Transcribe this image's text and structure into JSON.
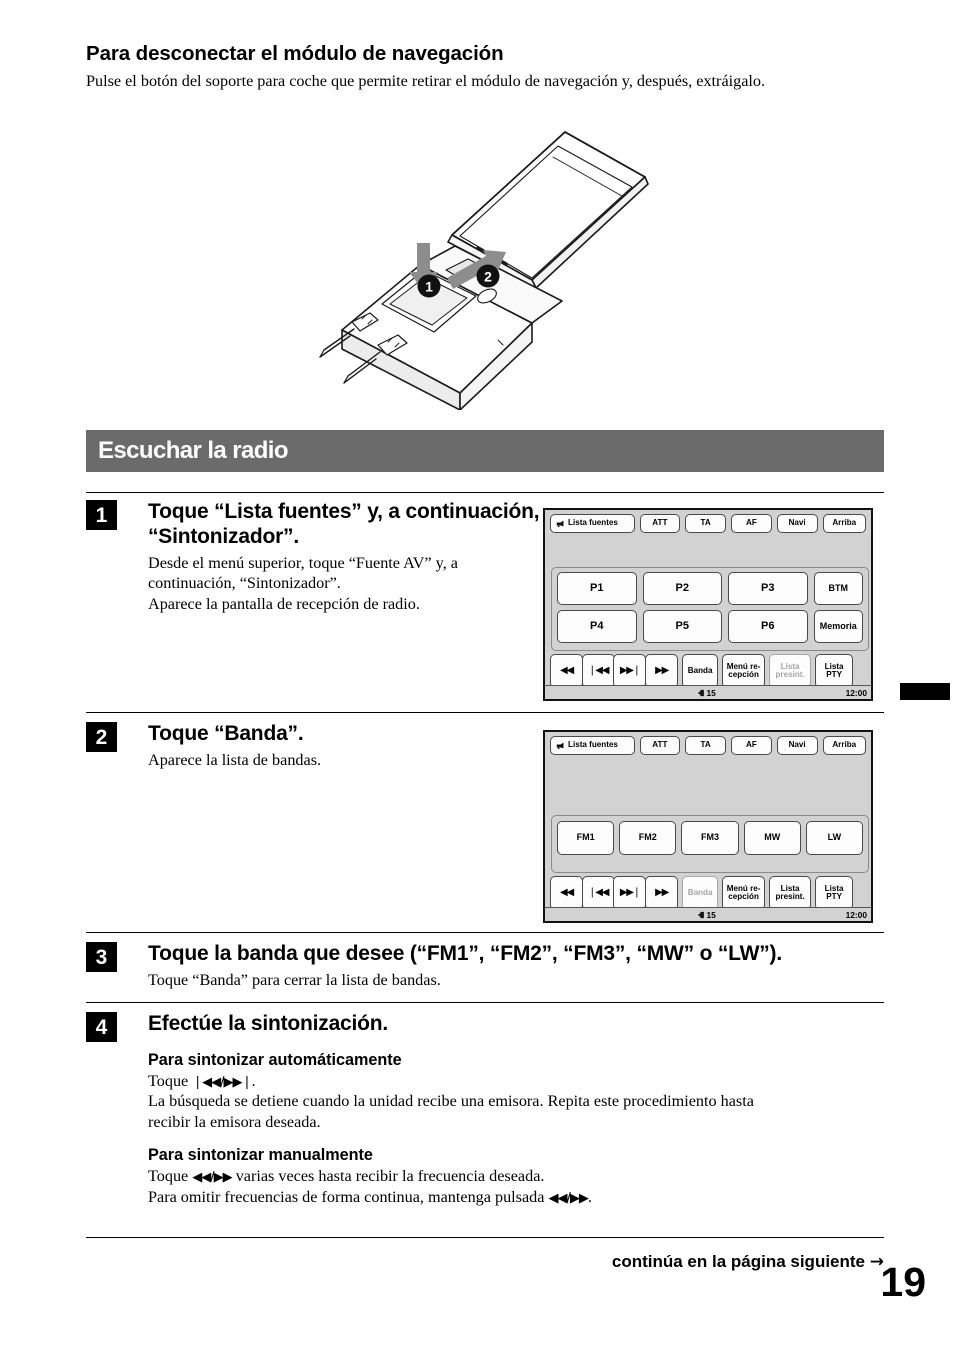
{
  "intro": {
    "heading": "Para desconectar el módulo de navegación",
    "body": "Pulse el botón del soporte para coche que permite retirar el módulo de navegación y, después, extráigalo."
  },
  "illustration": {
    "name": "navigation-module-removal-diagram",
    "callout_1": "1",
    "callout_2": "2"
  },
  "section": {
    "banner_title": "Escuchar la radio"
  },
  "steps": [
    {
      "number": "1",
      "title": "Toque “Lista fuentes” y, a continuación, “Sintonizador”.",
      "desc_lines": [
        "Desde el menú superior, toque “Fuente AV” y, a",
        "continuación, “Sintonizador”.",
        "Aparece la pantalla de recepción de radio."
      ]
    },
    {
      "number": "2",
      "title": "Toque “Banda”.",
      "desc_lines": [
        "Aparece la lista de bandas."
      ]
    },
    {
      "number": "3",
      "title": "Toque la banda que desee (“FM1”, “FM2”, “FM3”, “MW” o “LW”).",
      "desc_lines": [
        "Toque “Banda” para cerrar la lista de bandas."
      ]
    },
    {
      "number": "4",
      "title": "Efectúe la sintonización.",
      "sub_sections": [
        {
          "heading": "Para sintonizar automáticamente",
          "line1_pre": "Toque ",
          "line1_glyph": "❘◀◀/▶▶❘",
          "line1_post": ".",
          "line2": "La búsqueda se detiene cuando la unidad recibe una emisora. Repita este procedimiento hasta",
          "line3": "recibir la emisora deseada."
        },
        {
          "heading": "Para sintonizar manualmente",
          "line1_pre": "Toque ",
          "line1_glyph": "◀◀/▶▶",
          "line1_post": " varias veces hasta recibir la frecuencia deseada.",
          "line2_pre": "Para omitir frecuencias de forma continua, mantenga pulsada ",
          "line2_glyph": "◀◀/▶▶",
          "line2_post": "."
        }
      ]
    }
  ],
  "screen1": {
    "top_buttons": [
      "Lista fuentes",
      "ATT",
      "TA",
      "AF",
      "Navi",
      "Arriba"
    ],
    "presets_row1": [
      "P1",
      "P2",
      "P3"
    ],
    "presets_row2": [
      "P4",
      "P5",
      "P6"
    ],
    "side_buttons": [
      "BTM",
      "Memoria"
    ],
    "transport": [
      "◀◀",
      "❘◀◀",
      "▶▶❘",
      "▶▶"
    ],
    "control_banda": "Banda",
    "control_menu": "Menú re-\ncepción",
    "control_preset_list": "Lista\npresint.",
    "control_pty": "Lista\nPTY",
    "volume": "15",
    "clock": "12:00",
    "disabled": [
      "Lista presint."
    ]
  },
  "screen2": {
    "top_buttons": [
      "Lista fuentes",
      "ATT",
      "TA",
      "AF",
      "Navi",
      "Arriba"
    ],
    "bands": [
      "FM1",
      "FM2",
      "FM3",
      "MW",
      "LW"
    ],
    "transport": [
      "◀◀",
      "❘◀◀",
      "▶▶❘",
      "▶▶"
    ],
    "control_banda": "Banda",
    "control_menu": "Menú re-\ncepción",
    "control_preset_list": "Lista\npresint.",
    "control_pty": "Lista\nPTY",
    "volume": "15",
    "clock": "12:00",
    "disabled": [
      "Banda"
    ]
  },
  "footer": {
    "note": "continúa en la página siguiente",
    "arrow": "→",
    "page_number": "19"
  },
  "colors": {
    "banner_bg": "#6b6b6b",
    "screen_bg": "#d2d2d2",
    "button_bg": "#fdfdfd",
    "disabled_text": "#a6a6a6",
    "ink": "#000000"
  }
}
